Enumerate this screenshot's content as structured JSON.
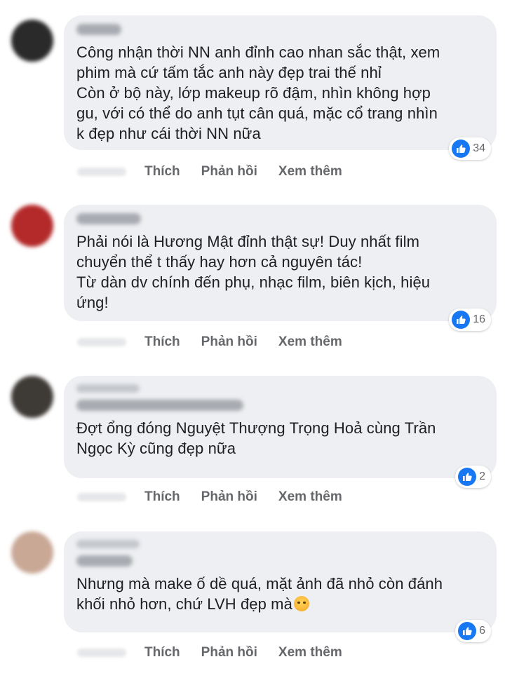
{
  "comments": [
    {
      "text": "Công nhận thời NN anh đỉnh cao nhan sắc thật, xem\nphim mà cứ tấm tắc anh này đẹp trai thế nhỉ\nCòn ở bộ này, lớp makeup rõ đậm, nhìn không hợp\ngu, với có thể do anh tụt cân quá, mặc cổ trang nhìn\nk đẹp như cái thời NN nữa",
      "reactions": "34",
      "avatar_color": "#2a2a2a",
      "actions": [
        "Thích",
        "Phản hồi",
        "Xem thêm"
      ]
    },
    {
      "text": "Phải nói là Hương Mật đỉnh thật sự! Duy nhất film\nchuyển thể t thấy hay hơn cả nguyên tác!\nTừ dàn dv chính đến phụ, nhạc film, biên kịch, hiệu\nứng!",
      "reactions": "16",
      "avatar_color": "#b42a2a",
      "actions": [
        "Thích",
        "Phản hồi",
        "Xem thêm"
      ]
    },
    {
      "text": "Đợt ổng đóng Nguyệt Thượng Trọng Hoả cùng Trần\nNgọc Kỳ cũng đẹp nữa",
      "reactions": "2",
      "avatar_color": "#3e3a36",
      "actions": [
        "Thích",
        "Phản hồi",
        "Xem thêm"
      ]
    },
    {
      "text": "Nhưng mà make ố dề quá, mặt ảnh đã nhỏ còn đánh\nkhối nhỏ hơn, chứ LVH đẹp mà",
      "reactions": "6",
      "avatar_color": "#c9a896",
      "actions": [
        "Thích",
        "Phản hồi",
        "Xem thêm"
      ],
      "emoji": "smiling-face-with-tear"
    }
  ],
  "colors": {
    "bubble": "#eeeff2",
    "text": "#1c1e21",
    "secondary": "#65676b",
    "like": "#1877f2"
  }
}
